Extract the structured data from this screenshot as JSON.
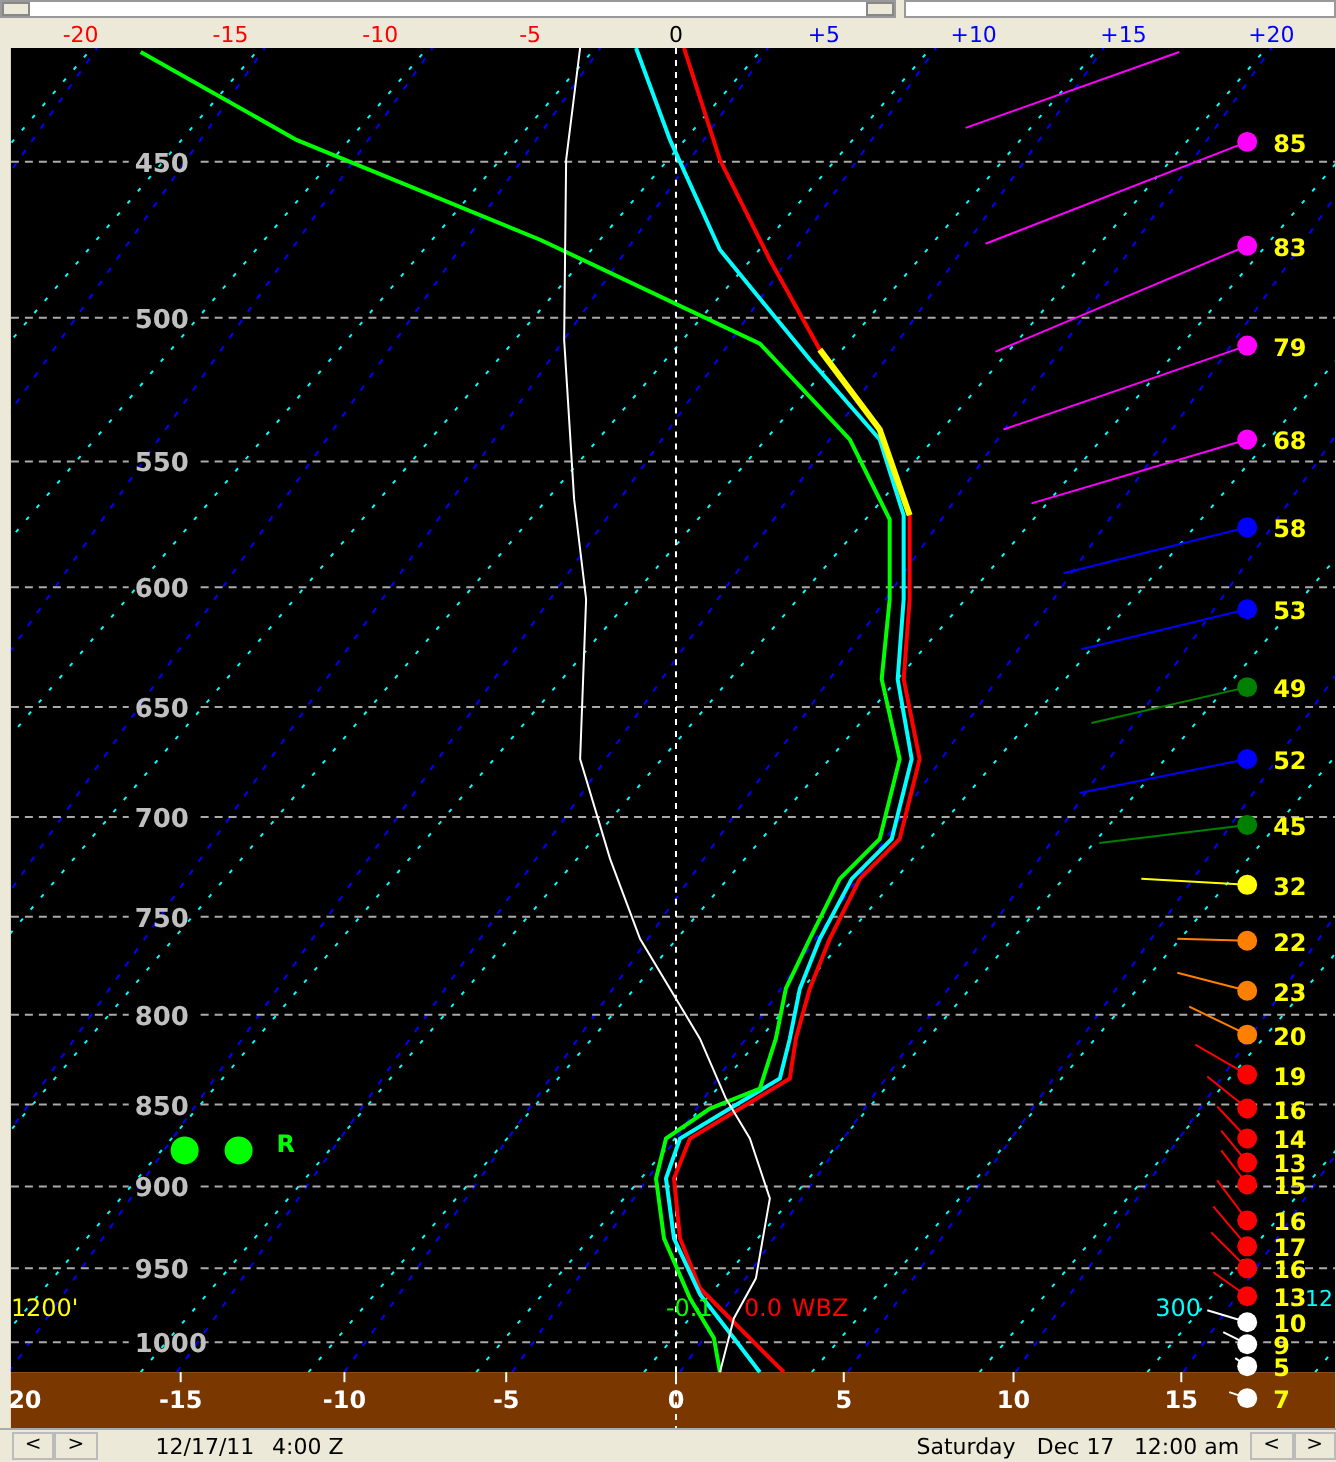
{
  "top_axis": [
    {
      "text": "-20",
      "kind": "negative"
    },
    {
      "text": "-15",
      "kind": "negative"
    },
    {
      "text": "-10",
      "kind": "negative"
    },
    {
      "text": "-5",
      "kind": "negative"
    },
    {
      "text": "0",
      "kind": "zero"
    },
    {
      "text": "+5",
      "kind": "positive"
    },
    {
      "text": "+10",
      "kind": "positive"
    },
    {
      "text": "+15",
      "kind": "positive"
    },
    {
      "text": "+20",
      "kind": "positive"
    }
  ],
  "pressure_levels": [
    "450",
    "500",
    "550",
    "600",
    "650",
    "700",
    "750",
    "800",
    "850",
    "900",
    "950",
    "1000"
  ],
  "bottom_axis": [
    "20",
    "-15",
    "-10",
    "-5",
    "0",
    "5",
    "10",
    "15"
  ],
  "winds": [
    {
      "speed": "85",
      "color": "#ff00ff"
    },
    {
      "speed": "83",
      "color": "#ff00ff"
    },
    {
      "speed": "79",
      "color": "#ff00ff"
    },
    {
      "speed": "68",
      "color": "#ff00ff"
    },
    {
      "speed": "58",
      "color": "#0000ff"
    },
    {
      "speed": "53",
      "color": "#0000ff"
    },
    {
      "speed": "49",
      "color": "#008000"
    },
    {
      "speed": "52",
      "color": "#0000ff"
    },
    {
      "speed": "45",
      "color": "#008000"
    },
    {
      "speed": "32",
      "color": "#ffff00"
    },
    {
      "speed": "22",
      "color": "#ff8000"
    },
    {
      "speed": "23",
      "color": "#ff8000"
    },
    {
      "speed": "20",
      "color": "#ff8000"
    },
    {
      "speed": "19",
      "color": "#ff0000"
    },
    {
      "speed": "16",
      "color": "#ff0000"
    },
    {
      "speed": "14",
      "color": "#ff0000"
    },
    {
      "speed": "13",
      "color": "#ff0000"
    },
    {
      "speed": "15",
      "color": "#ff0000"
    },
    {
      "speed": "16",
      "color": "#ff0000"
    },
    {
      "speed": "17",
      "color": "#ff0000"
    },
    {
      "speed": "16",
      "color": "#ff0000"
    },
    {
      "speed": "13",
      "color": "#ff0000"
    },
    {
      "speed": "10",
      "color": "#ffffff"
    },
    {
      "speed": "9",
      "color": "#ffffff"
    },
    {
      "speed": "5",
      "color": "#ffffff"
    },
    {
      "speed": "7",
      "color": "#ffffff"
    }
  ],
  "annotations": [
    {
      "text": "R",
      "color": "#00ff00"
    },
    {
      "text": "1200'",
      "color": "#ffff00"
    },
    {
      "text": "-0.1",
      "color": "#00ff00"
    },
    {
      "text": "0.0",
      "color": "#ff0000"
    },
    {
      "text": "WBZ",
      "color": "#ff0000"
    },
    {
      "text": "300",
      "color": "#00ffff"
    },
    {
      "text": "12",
      "color": "#00ffff"
    }
  ],
  "status_bar": {
    "left_nav": [
      "<",
      ">"
    ],
    "date": "12/17/11",
    "time": "4:00 Z",
    "day": "Saturday",
    "valid_date": "Dec 17",
    "valid_time": "12:00 am",
    "right_nav": [
      "<",
      ">"
    ]
  }
}
